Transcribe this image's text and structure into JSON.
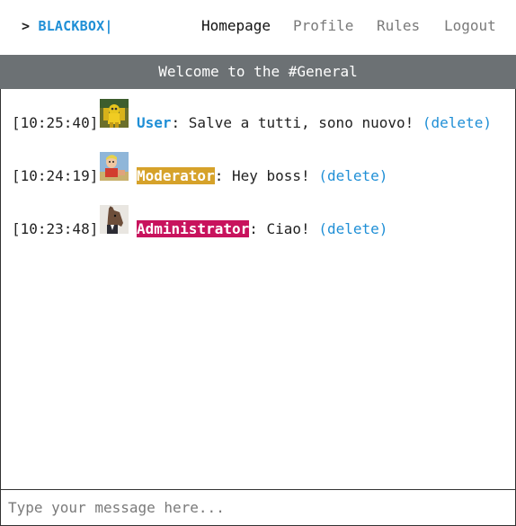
{
  "brand": {
    "prompt": ">",
    "name": "BLACKBOX|"
  },
  "nav": {
    "items": [
      {
        "label": "Homepage",
        "active": true
      },
      {
        "label": "Profile",
        "active": false
      },
      {
        "label": "Rules",
        "active": false
      },
      {
        "label": "Logout",
        "active": false
      }
    ]
  },
  "banner": {
    "text": "Welcome to the #General"
  },
  "messages": [
    {
      "time": "[10:25:40]",
      "user": "User",
      "role": "user",
      "text": ": Salve a tutti, sono nuovo!",
      "delete_label": "(delete)",
      "avatar": "yellow-robot-avatar"
    },
    {
      "time": "[10:24:19]",
      "user": "Moderator",
      "role": "moderator",
      "text": ": Hey boss!",
      "delete_label": "(delete)",
      "avatar": "cartoon-man-avatar"
    },
    {
      "time": "[10:23:48]",
      "user": "Administrator",
      "role": "admin",
      "text": ": Ciao!",
      "delete_label": "(delete)",
      "avatar": "horse-avatar"
    }
  ],
  "composer": {
    "placeholder": "Type your message here...",
    "value": ""
  },
  "colors": {
    "accent": "#1f8fd6",
    "banner": "#6c7174",
    "moderator": "#d6a22a",
    "admin": "#c8135d"
  }
}
